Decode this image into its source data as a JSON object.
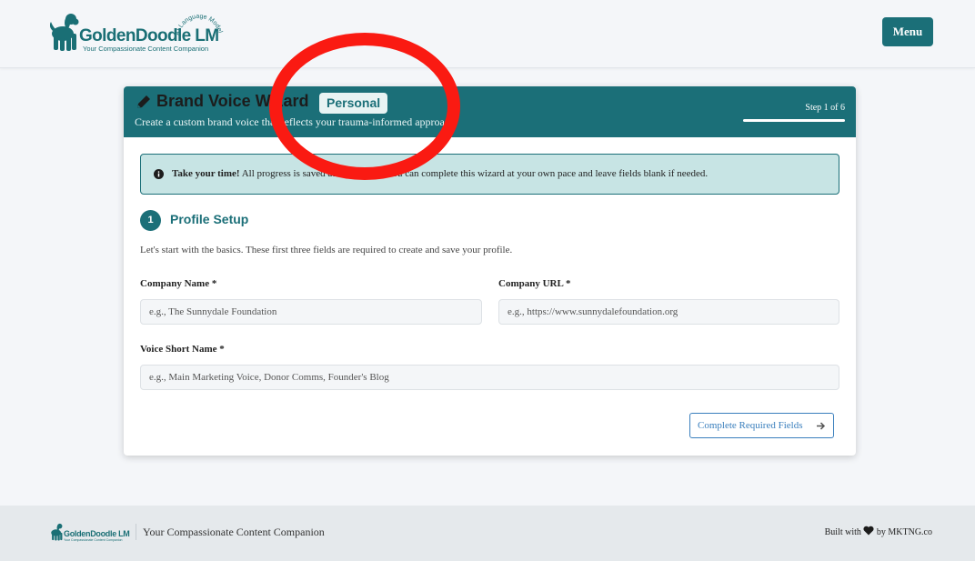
{
  "header": {
    "logo_name": "GoldenDoodle LM",
    "logo_arc_text": "AI Language Model",
    "logo_tagline": "Your Compassionate Content Companion",
    "menu_label": "Menu"
  },
  "wizard": {
    "title": "Brand Voice Wizard",
    "badge": "Personal",
    "subtitle": "Create a custom brand voice that reflects your trauma-informed approach",
    "step_label": "Step 1 of 6",
    "progress": 0.1667
  },
  "alert": {
    "bold": "Take your time!",
    "text": " All progress is saved automatically. You can complete this wizard at your own pace and leave fields blank if needed."
  },
  "section": {
    "number": "1",
    "title": "Profile Setup",
    "description": "Let's start with the basics. These first three fields are required to create and save your profile."
  },
  "fields": {
    "company_name": {
      "label": "Company Name *",
      "placeholder": "e.g., The Sunnydale Foundation"
    },
    "company_url": {
      "label": "Company URL *",
      "placeholder": "e.g., https://www.sunnydalefoundation.org"
    },
    "voice_short_name": {
      "label": "Voice Short Name *",
      "placeholder": "e.g., Main Marketing Voice, Donor Comms, Founder's Blog"
    }
  },
  "actions": {
    "complete_label": "Complete Required Fields"
  },
  "footer": {
    "logo_name": "GoldenDoodle LM",
    "logo_tagline": "Your Compassionate Content Companion",
    "tagline": "Your Compassionate Content Companion",
    "built_prefix": "Built with",
    "built_suffix": "by MKTNG.co"
  },
  "colors": {
    "brand_teal": "#1b6f78",
    "alert_bg": "#c7e4e4",
    "link_blue": "#3a7fbd",
    "annotation_red": "#fa1a12"
  },
  "icons": [
    "dog-logo-icon",
    "pencil-icon",
    "info-circle-icon",
    "arrow-right-icon",
    "heart-icon"
  ]
}
